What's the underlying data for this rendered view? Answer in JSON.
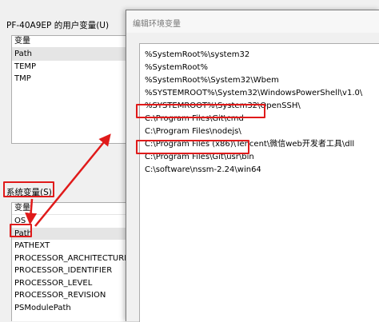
{
  "user_vars": {
    "title": "PF-40A9EP 的用户变量(U)",
    "header": "变量",
    "items": [
      "Path",
      "TEMP",
      "TMP"
    ]
  },
  "system_vars": {
    "title": "系统变量(S)",
    "header": "变量",
    "items": [
      "OS",
      "Path",
      "PATHEXT",
      "PROCESSOR_ARCHITECTURE",
      "PROCESSOR_IDENTIFIER",
      "PROCESSOR_LEVEL",
      "PROCESSOR_REVISION",
      "PSModulePath"
    ]
  },
  "edit_dialog": {
    "title": "编辑环境变量",
    "paths": [
      "%SystemRoot%\\system32",
      "%SystemRoot%",
      "%SystemRoot%\\System32\\Wbem",
      "%SYSTEMROOT%\\System32\\WindowsPowerShell\\v1.0\\",
      "%SYSTEMROOT%\\System32\\OpenSSH\\",
      "C:\\Program Files\\Git\\cmd",
      "C:\\Program Files\\nodejs\\",
      "C:\\Program Files (x86)\\Tencent\\微信web开发者工具\\dll",
      "C:\\Program Files\\Git\\usr\\bin",
      "C:\\software\\nssm-2.24\\win64"
    ]
  },
  "colors": {
    "highlight": "#e01a1a",
    "selected_row": "#e5e5e5"
  }
}
